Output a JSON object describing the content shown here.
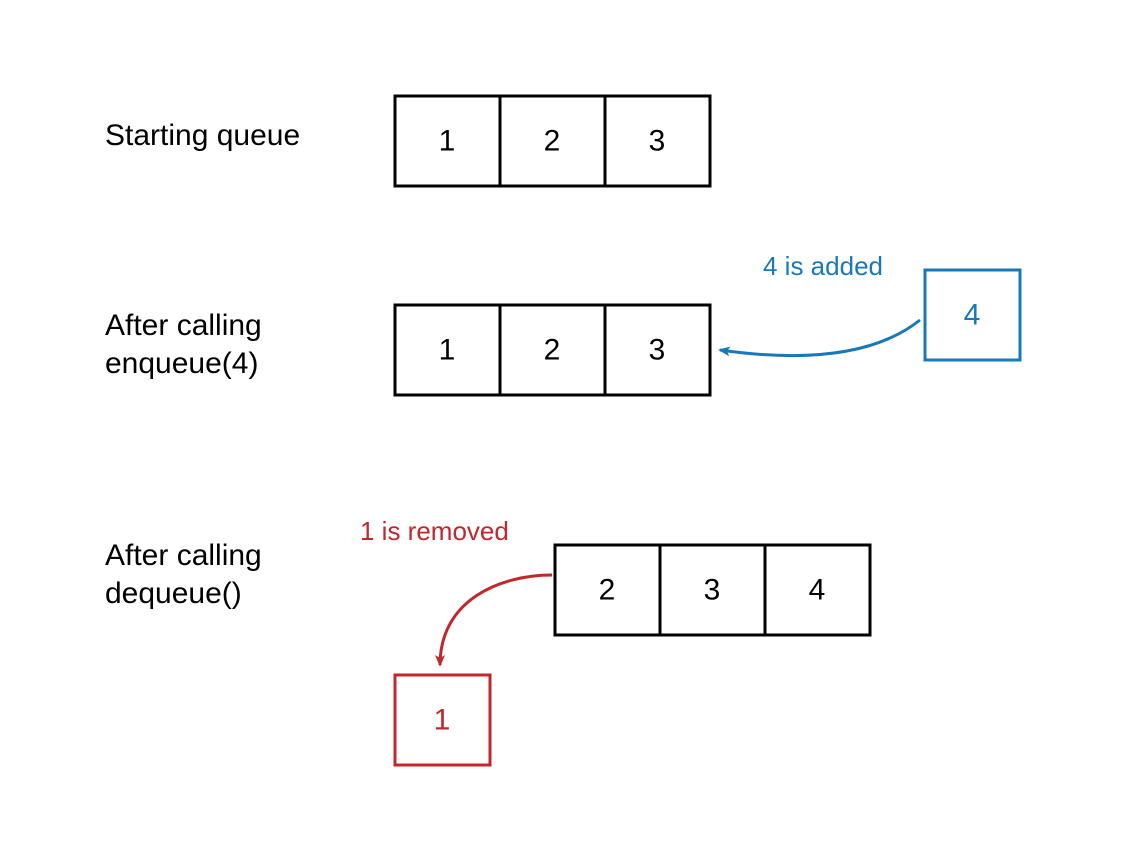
{
  "labels": {
    "starting": "Starting queue",
    "after_enqueue_l1": "After calling",
    "after_enqueue_l2": "enqueue(4)",
    "after_dequeue_l1": "After calling",
    "after_dequeue_l2": "dequeue()"
  },
  "queues": {
    "starting": {
      "cells": [
        "1",
        "2",
        "3"
      ]
    },
    "after_enqueue": {
      "cells": [
        "1",
        "2",
        "3"
      ],
      "incoming": "4"
    },
    "after_dequeue": {
      "cells": [
        "2",
        "3",
        "4"
      ],
      "removed": "1"
    }
  },
  "annotations": {
    "added": "4 is added",
    "removed": "1 is removed"
  },
  "colors": {
    "blue": "#1879ba",
    "red": "#c1272d",
    "black": "#000000"
  }
}
